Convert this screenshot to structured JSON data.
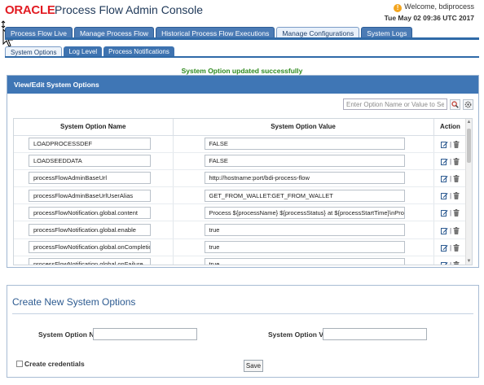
{
  "header": {
    "logo": "ORACLE",
    "app_title": "Process Flow Admin Console",
    "welcome": "Welcome, bdiprocess",
    "datetime": "Tue May 02 09:36 UTC 2017"
  },
  "main_tabs": [
    {
      "label": "Process Flow Live"
    },
    {
      "label": "Manage Process Flow"
    },
    {
      "label": "Historical Process Flow Executions"
    },
    {
      "label": "Manage Configurations"
    },
    {
      "label": "System Logs"
    }
  ],
  "sub_tabs": [
    {
      "label": "System Options"
    },
    {
      "label": "Log Level"
    },
    {
      "label": "Process Notifications"
    }
  ],
  "success_message": "System Option updated successfully",
  "view_panel": {
    "title": "View/Edit System Options",
    "search_placeholder": "Enter Option Name or Value to Search...",
    "columns": {
      "name": "System Option Name",
      "value": "System Option Value",
      "action": "Action"
    },
    "rows": [
      {
        "name": "LOADPROCESSDEF",
        "value": "FALSE"
      },
      {
        "name": "LOADSEEDDATA",
        "value": "FALSE"
      },
      {
        "name": "processFlowAdminBaseUrl",
        "value": "http://hostname:port/bdi-process-flow"
      },
      {
        "name": "processFlowAdminBaseUrlUserAlias",
        "value": "GET_FROM_WALLET:GET_FROM_WALLET"
      },
      {
        "name": "processFlowNotification.global.content",
        "value": "Process ${processName} ${processStatus} at ${processStartTime}\\nProcess Execution"
      },
      {
        "name": "processFlowNotification.global.enable",
        "value": "true"
      },
      {
        "name": "processFlowNotification.global.onCompletion",
        "value": "true"
      },
      {
        "name": "processFlowNotification.global.onFailure",
        "value": "true"
      }
    ]
  },
  "create_panel": {
    "title": "Create New System Options",
    "name_label": "System Option Name",
    "value_label": "System Option Value",
    "name_value": "",
    "value_value": "",
    "credentials_label": "Create credentials",
    "credentials_checked": false,
    "save_label": "Save"
  },
  "colors": {
    "oracle_red": "#e21b22",
    "tab_blue": "#4b7bb5",
    "panel_header": "#3f76b5",
    "success_green": "#2f8a1e",
    "create_title": "#2d5b91"
  }
}
